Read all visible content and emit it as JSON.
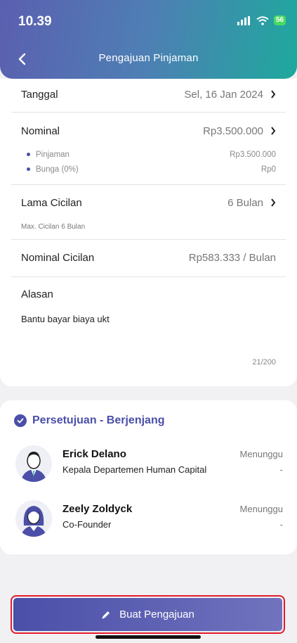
{
  "status_bar": {
    "time": "10.39",
    "battery": "56"
  },
  "header": {
    "title": "Pengajuan Pinjaman"
  },
  "form": {
    "date_label": "Tanggal",
    "date_value": "Sel, 16 Jan 2024",
    "nominal_label": "Nominal",
    "nominal_value": "Rp3.500.000",
    "breakdown": [
      {
        "label": "Pinjaman",
        "value": "Rp3.500.000"
      },
      {
        "label": "Bunga (0%)",
        "value": "Rp0"
      }
    ],
    "tenor_label": "Lama Cicilan",
    "tenor_value": "6 Bulan",
    "tenor_hint": "Max. Cicilan 6 Bulan",
    "installment_label": "Nominal Cicilan",
    "installment_value": "Rp583.333 / Bulan",
    "reason_label": "Alasan",
    "reason_value": "Bantu bayar biaya ukt",
    "reason_counter": "21/200"
  },
  "approval": {
    "title": "Persetujuan - Berjenjang",
    "approvers": [
      {
        "name": "Erick Delano",
        "role": "Kepala Departemen Human Capital",
        "status": "Menunggu",
        "date": "-",
        "avatar_icon": "male-avatar-icon"
      },
      {
        "name": "Zeely Zoldyck",
        "role": "Co-Founder",
        "status": "Menunggu",
        "date": "-",
        "avatar_icon": "female-avatar-icon"
      }
    ]
  },
  "submit": {
    "label": "Buat Pengajuan",
    "icon": "pencil-icon"
  },
  "colors": {
    "primary": "#4b4fa8",
    "accent_teal": "#1ea99d",
    "highlight": "#e01b2c"
  }
}
